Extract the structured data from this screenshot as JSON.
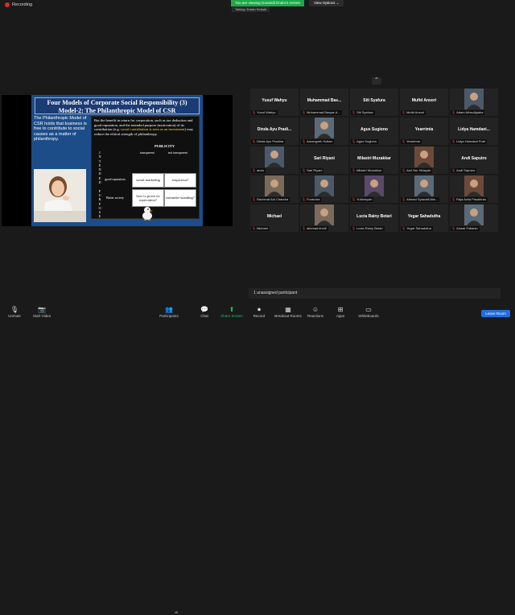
{
  "top": {
    "recording": "Recording",
    "share_banner": "You are viewing Gonandi Endro's screen",
    "view_options": "View Options",
    "talking": "Talking: Edwin Setiadi"
  },
  "slide": {
    "title_line1": "Four Models of Corporate Social Responsibility (3)",
    "title_line2": "Model-2: The Philanthropic Model of CSR",
    "left_text": "The Philanthropic Model of CSR holds that business is free to contribute to social causes as a matter of philanthropy.",
    "right_text_a": "But the benefit in return for corporation, such as tax deduction and good reputation, and the intended purpose (motivation) of its contribution (e.g. ",
    "right_text_hl": "social contribution is seen as an investment",
    "right_text_b": ") may reduce the ethical strength of philanthropy.",
    "publicity": "PUBLICITY",
    "col_transparent": "transparent",
    "col_not_transparent": "not transparent",
    "vertical_label": "INTENDED PURPOSE",
    "row_good": "good reputation",
    "row_better": "Better society",
    "cell_1": "social marketing",
    "cell_2": "suspicious?",
    "cell_3": "how to prove its motivation?",
    "cell_4": "misunder-standing?"
  },
  "participants": [
    {
      "name": "Yusuf Wahyu",
      "label": "Yusuf Wahyu",
      "photo": false
    },
    {
      "name": "Muhammad Bas...",
      "label": "Muhammad Basyar A...",
      "photo": false
    },
    {
      "name": "Siti Syafura",
      "label": "Siti Syafura",
      "photo": false
    },
    {
      "name": "Mufid Ansori",
      "label": "Mufid Ansori",
      "photo": false
    },
    {
      "name": "",
      "label": "Adam Athaullgiaha",
      "photo": true
    },
    {
      "name": "Dinda Ayu Pradi...",
      "label": "Dinda Ayu Pradina",
      "photo": false
    },
    {
      "name": "",
      "label": "Aurangzeb Sultan",
      "photo": true
    },
    {
      "name": "Agus Sugiono",
      "label": "Agus Sugiono",
      "photo": false
    },
    {
      "name": "Yearrimia",
      "label": "Yearrimia",
      "photo": false
    },
    {
      "name": "Lidya Hamdani...",
      "label": "Lidya Hamdani Putri",
      "photo": false
    },
    {
      "name": "",
      "label": "ando",
      "photo": true
    },
    {
      "name": "Sari Riyani",
      "label": "Sari Riyani",
      "photo": false
    },
    {
      "name": "Milastri Muzakkar",
      "label": "Milastri Muzakkar",
      "photo": false
    },
    {
      "name": "",
      "label": "Asri Nur Hidayah",
      "photo": true
    },
    {
      "name": "Andi Saputro",
      "label": "Andi Saputro",
      "photo": false
    },
    {
      "name": "",
      "label": "Rachmat Adi Chandra",
      "photo": true
    },
    {
      "name": "",
      "label": "Forandra",
      "photo": true
    },
    {
      "name": "",
      "label": "Yuliansyah",
      "photo": true
    },
    {
      "name": "",
      "label": "Ahmad Syawalli Alw...",
      "photo": true
    },
    {
      "name": "",
      "label": "Raja Aulia Pasaleras",
      "photo": true
    },
    {
      "name": "Michael",
      "label": "Michael",
      "photo": false
    },
    {
      "name": "",
      "label": "akhmad kholil",
      "photo": true
    },
    {
      "name": "Lucia Rainy Betari",
      "label": "Lucia Rainy Betari",
      "photo": false
    },
    {
      "name": "Yegar Sahadutha",
      "label": "Yegar Sahadutha",
      "photo": false
    },
    {
      "name": "",
      "label": "Anwar Fidianto",
      "photo": true
    }
  ],
  "unassigned": "1 unassigned participant",
  "toolbar": {
    "unmute": "Unmute",
    "start_video": "Start Video",
    "participants": "Participants",
    "participants_count": "48",
    "chat": "Chat",
    "share_screen": "Share Screen",
    "record": "Record",
    "breakout_rooms": "Breakout Rooms",
    "reactions": "Reactions",
    "apps": "Apps",
    "whiteboards": "Whiteboards",
    "leave": "Leave Room"
  }
}
